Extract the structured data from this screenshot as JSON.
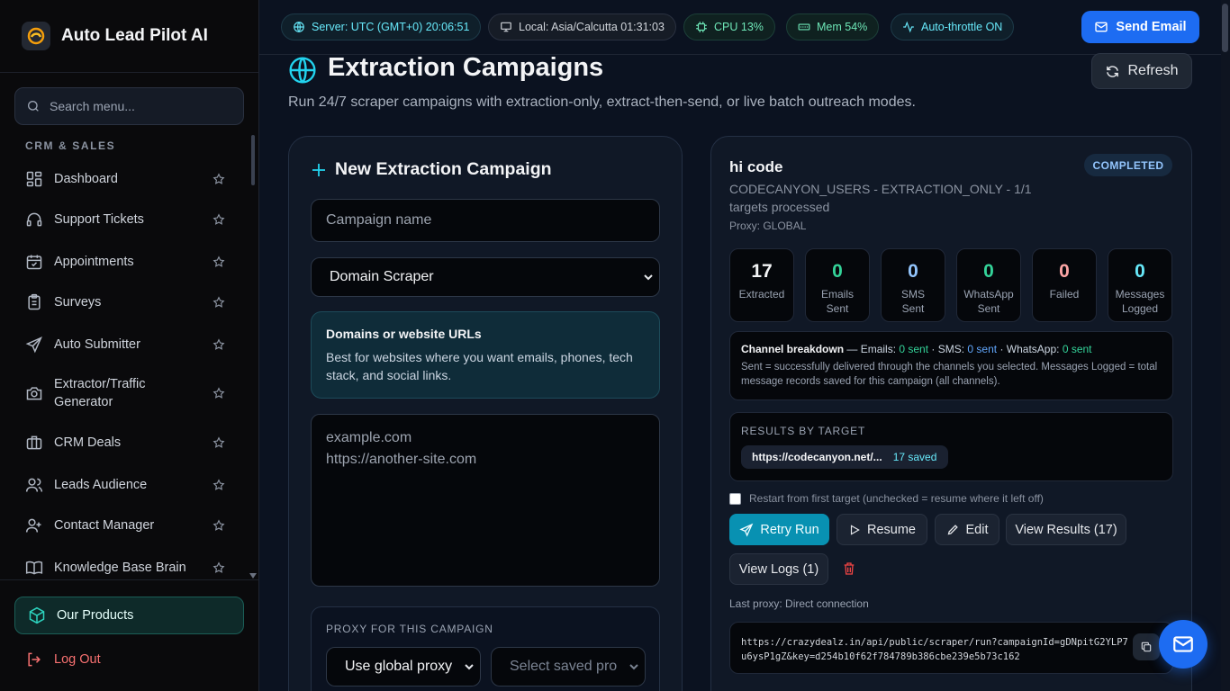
{
  "app": {
    "name": "Auto Lead Pilot AI"
  },
  "sidebar": {
    "search_placeholder": "Search menu...",
    "section": "CRM & SALES",
    "items": [
      {
        "label": "Dashboard",
        "icon": "dashboard-icon"
      },
      {
        "label": "Support Tickets",
        "icon": "headset-icon"
      },
      {
        "label": "Appointments",
        "icon": "calendar-icon"
      },
      {
        "label": "Surveys",
        "icon": "clipboard-icon"
      },
      {
        "label": "Auto Submitter",
        "icon": "send-icon"
      },
      {
        "label": "Extractor/Traffic Generator",
        "icon": "camera-icon"
      },
      {
        "label": "CRM Deals",
        "icon": "briefcase-icon"
      },
      {
        "label": "Leads Audience",
        "icon": "users-icon"
      },
      {
        "label": "Contact Manager",
        "icon": "user-icon"
      },
      {
        "label": "Knowledge Base Brain",
        "icon": "book-icon"
      }
    ],
    "our_products": "Our Products",
    "logout": "Log Out"
  },
  "topbar": {
    "server": "Server: UTC (GMT+0) 20:06:51",
    "local": "Local: Asia/Calcutta 01:31:03",
    "cpu": "CPU 13%",
    "mem": "Mem 54%",
    "throttle": "Auto-throttle ON",
    "send_email": "Send Email"
  },
  "page": {
    "title": "Extraction Campaigns",
    "subtitle": "Run 24/7 scraper campaigns with extraction-only, extract-then-send, or live batch outreach modes.",
    "refresh": "Refresh"
  },
  "new_campaign": {
    "title": "New Extraction Campaign",
    "name_placeholder": "Campaign name",
    "scraper_type": "Domain Scraper",
    "info_title": "Domains or website URLs",
    "info_text": "Best for websites where you want emails, phones, tech stack, and social links.",
    "domains_placeholder_1": "example.com",
    "domains_placeholder_2": "https://another-site.com",
    "proxy_label": "PROXY FOR THIS CAMPAIGN",
    "proxy_select": "Use global proxy",
    "saved_proxy_placeholder": "Select saved pro"
  },
  "campaign": {
    "name": "hi code",
    "status": "COMPLETED",
    "meta": "CODECANYON_USERS - EXTRACTION_ONLY - 1/1 targets processed",
    "proxy": "Proxy: GLOBAL",
    "stats": [
      {
        "value": "17",
        "label": "Extracted",
        "color": "#f3f4f6"
      },
      {
        "value": "0",
        "label": "Emails Sent",
        "color": "#34d399"
      },
      {
        "value": "0",
        "label": "SMS Sent",
        "color": "#93c5fd"
      },
      {
        "value": "0",
        "label": "WhatsApp Sent",
        "color": "#34d399"
      },
      {
        "value": "0",
        "label": "Failed",
        "color": "#fca5a5"
      },
      {
        "value": "0",
        "label": "Messages Logged",
        "color": "#67e8f9"
      }
    ],
    "breakdown": {
      "title": "Channel breakdown",
      "emails_label": " — Emails: ",
      "emails": "0 sent",
      "sms_label": " · SMS: ",
      "sms": "0 sent",
      "whatsapp_label": " · WhatsApp: ",
      "whatsapp": "0 sent",
      "note": "Sent = successfully delivered through the channels you selected. Messages Logged = total message records saved for this campaign (all channels)."
    },
    "results_label": "RESULTS BY TARGET",
    "target_url": "https://codecanyon.net/...",
    "target_count": "17 saved",
    "restart_label": "Restart from first target (unchecked = resume where it left off)",
    "buttons": {
      "retry": "Retry Run",
      "resume": "Resume",
      "edit": "Edit",
      "view_results": "View Results (17)",
      "view_logs": "View Logs (1)"
    },
    "last_proxy": "Last proxy: Direct connection",
    "run_url": "https://crazydealz.in/api/public/scraper/run?campaignId=gDNpitG2YLP7u6ysP1gZ&key=d254b10f62f784789b386cbe239e5b73c162"
  }
}
